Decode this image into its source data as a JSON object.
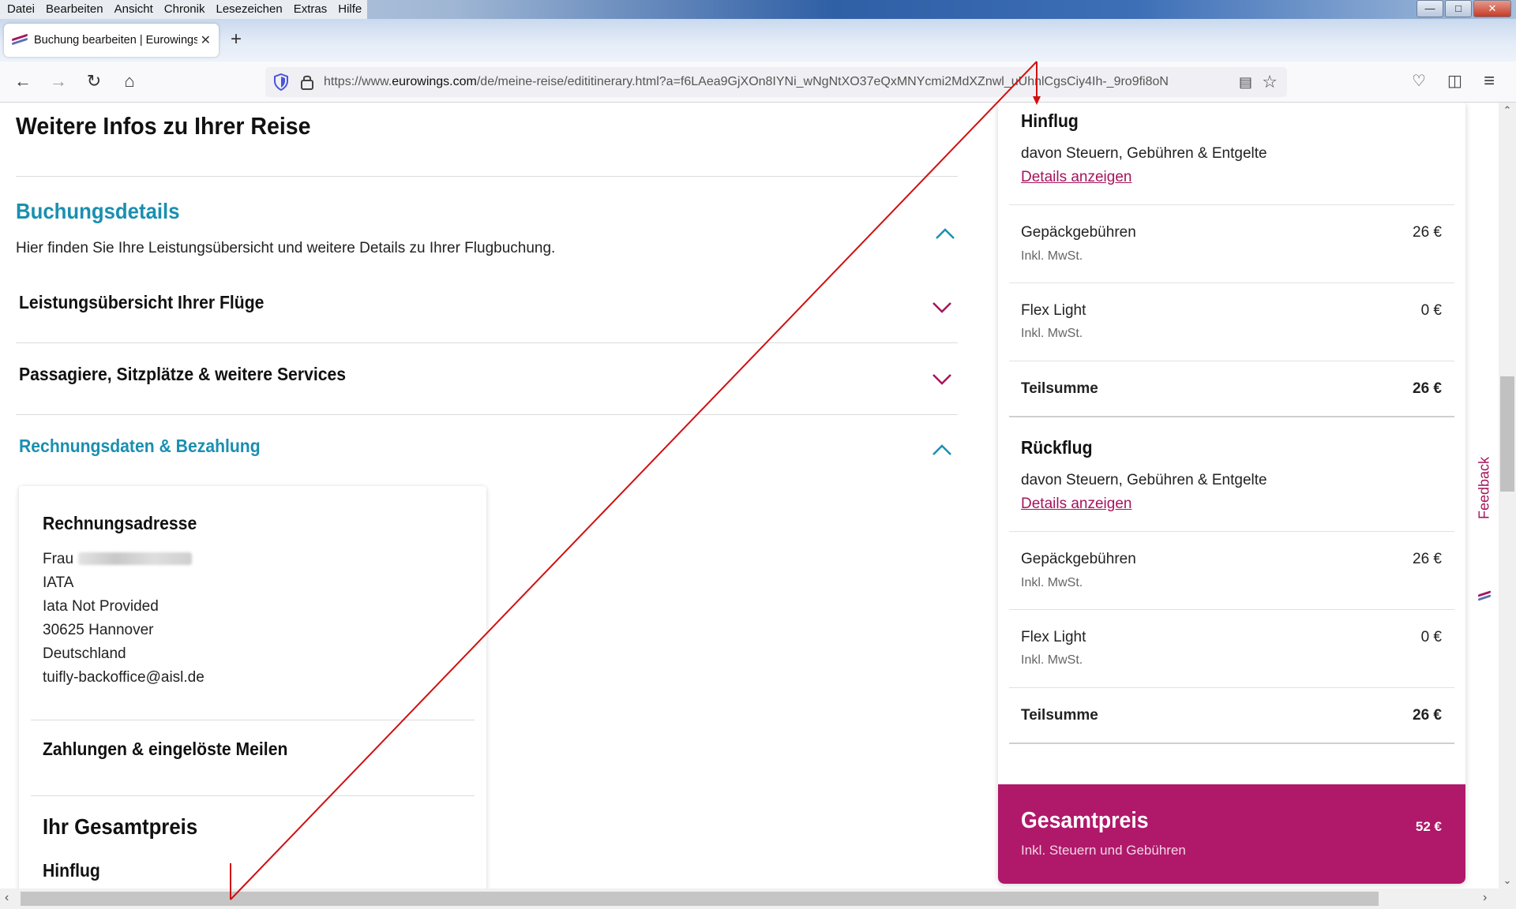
{
  "menubar": {
    "items": [
      "Datei",
      "Bearbeiten",
      "Ansicht",
      "Chronik",
      "Lesezeichen",
      "Extras",
      "Hilfe"
    ],
    "controls": {
      "minimize": "—",
      "maximize": "□",
      "close": "✕"
    }
  },
  "tabs": {
    "active_title": "Buchung bearbeiten | Eurowings",
    "close_glyph": "✕",
    "new_tab_glyph": "+"
  },
  "navbar": {
    "back": "←",
    "forward": "→",
    "reload": "↻",
    "home": "⌂",
    "url_prefix": "https://www.",
    "url_domain": "eurowings.com",
    "url_path": "/de/meine-reise/edititinerary.html?a=f6LAea9GjXOn8IYNi_wNgNtXO37eQxMNYcmi2MdXZnwl_uUhnlCgsCiy4Ih-_9ro9fi8oN",
    "reader_glyph": "▤",
    "bookmark_glyph": "☆",
    "pocket_glyph": "♡",
    "sidebar_glyph": "◫",
    "menu_glyph": "≡"
  },
  "page": {
    "main_title": "Weitere Infos zu Ihrer Reise",
    "section_title": "Buchungsdetails",
    "section_desc": "Hier finden Sie Ihre Leistungsübersicht und weitere Details zu Ihrer Flugbuchung.",
    "accordion": [
      {
        "title": "Leistungsübersicht Ihrer Flüge",
        "expanded": false
      },
      {
        "title": "Passagiere, Sitzplätze & weitere Services",
        "expanded": false
      },
      {
        "title": "Rechnungsdaten & Bezahlung",
        "expanded": true
      }
    ],
    "billing": {
      "title": "Rechnungsadresse",
      "salutation": "Frau",
      "lines": [
        "IATA",
        "Iata Not Provided",
        "30625 Hannover",
        "Deutschland",
        "tuifly-backoffice@aisl.de"
      ],
      "payments_title": "Zahlungen & eingelöste Meilen",
      "total_title": "Ihr Gesamtpreis",
      "outbound_title": "Hinflug"
    }
  },
  "price_panel": {
    "outbound": {
      "title": "Hinflug",
      "taxes_text": "davon Steuern, Gebühren & Entgelte",
      "details_link": "Details anzeigen",
      "items": [
        {
          "label": "Gepäckgebühren",
          "sub": "Inkl. MwSt.",
          "amount": "26 €"
        },
        {
          "label": "Flex Light",
          "sub": "Inkl. MwSt.",
          "amount": "0 €"
        }
      ],
      "subtotal_label": "Teilsumme",
      "subtotal_amount": "26 €"
    },
    "return": {
      "title": "Rückflug",
      "taxes_text": "davon Steuern, Gebühren & Entgelte",
      "details_link": "Details anzeigen",
      "items": [
        {
          "label": "Gepäckgebühren",
          "sub": "Inkl. MwSt.",
          "amount": "26 €"
        },
        {
          "label": "Flex Light",
          "sub": "Inkl. MwSt.",
          "amount": "0 €"
        }
      ],
      "subtotal_label": "Teilsumme",
      "subtotal_amount": "26 €"
    },
    "total": {
      "title": "Gesamtpreis",
      "sub": "Inkl. Steuern und Gebühren",
      "amount": "52 €"
    }
  },
  "feedback": {
    "label": "Feedback"
  },
  "colors": {
    "teal": "#1a8fb0",
    "magenta": "#a5145c",
    "total_bg": "#b0186a",
    "annotation": "#d01010"
  }
}
